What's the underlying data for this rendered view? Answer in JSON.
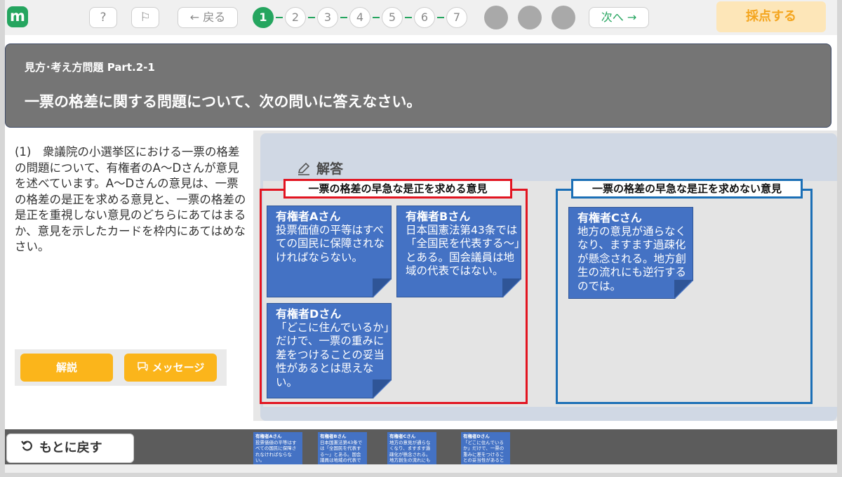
{
  "topbar": {
    "help_label": "?",
    "flag_label": "⚐",
    "back_label": "← 戻る",
    "steps": [
      "1",
      "2",
      "3",
      "4",
      "5",
      "6",
      "7"
    ],
    "active_step": "1",
    "next_label": "次へ →",
    "score_label": "採点する"
  },
  "header": {
    "subtitle": "見方･考え方問題 Part.2-1",
    "title": "一票の格差に関する問題について、次の問いに答えなさい。"
  },
  "question": {
    "text": "(1)　衆議院の小選挙区における一票の格差の問題について、有権者のA〜Dさんが意見を述べています。A〜Dさんの意見は、一票の格差の是正を求める意見と、一票の格差の是正を重視しない意見のどちらにあてはまるか、意見を示したカードを枠内にあてはめなさい。"
  },
  "tools": {
    "explanation_label": "解説",
    "message_label": "メッセージ"
  },
  "answer": {
    "label": "解答",
    "zone_correct_title": "一票の格差の早急な是正を求める意見",
    "zone_not_title": "一票の格差の早急な是正を求めない意見",
    "cards": {
      "a": {
        "name": "有権者Aさん",
        "text": "投票価値の平等はすべての国民に保障されなければならない。"
      },
      "b": {
        "name": "有権者Bさん",
        "text": "日本国憲法第43条では「全国民を代表する〜」とある。国会議員は地域の代表ではない。"
      },
      "c": {
        "name": "有権者Cさん",
        "text": "地方の意見が通らなくなり、ますます過疎化が懸念される。地方創生の流れにも逆行するのでは。"
      },
      "d": {
        "name": "有権者Dさん",
        "text": "「どこに住んでいるか」だけで、一票の重みに差をつけることの妥当性があるとは思えない。"
      }
    }
  },
  "bottom": {
    "reset_label": "もとに戻す",
    "minis": [
      {
        "name": "有権者Aさん",
        "text": "投票価値の平等はすべての国民に保障されなければならない。"
      },
      {
        "name": "有権者Bさん",
        "text": "日本国憲法第43条では「全国民を代表する〜」とある。国会議員は地域の代表で"
      },
      {
        "name": "有権者Cさん",
        "text": "地方の意見が通らなくなり、ますます過疎化が懸念される。地方創生の流れにも"
      },
      {
        "name": "有権者Dさん",
        "text": "「どこに住んでいるか」だけで、一票の重みに差をつけることの妥当性があると"
      }
    ]
  },
  "colors": {
    "brand_green": "#25a55f",
    "accent_orange": "#fbb51b",
    "card_blue": "#4472c4",
    "zone_red": "#e21420",
    "zone_blue": "#1b6fb6"
  }
}
